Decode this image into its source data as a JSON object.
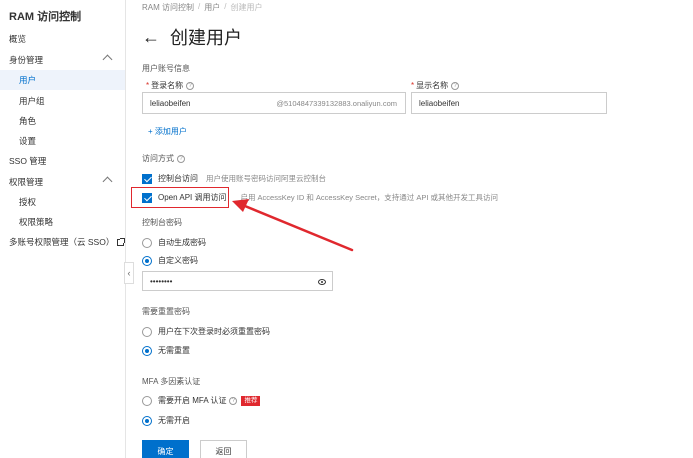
{
  "sidebar": {
    "title": "RAM 访问控制",
    "items": [
      {
        "label": "概览"
      },
      {
        "label": "身份管理"
      },
      {
        "label": "用户"
      },
      {
        "label": "用户组"
      },
      {
        "label": "角色"
      },
      {
        "label": "设置"
      },
      {
        "label": "SSO 管理"
      },
      {
        "label": "权限管理"
      },
      {
        "label": "授权"
      },
      {
        "label": "权限策略"
      },
      {
        "label": "多账号权限管理（云 SSO）"
      }
    ]
  },
  "breadcrumb": [
    "RAM 访问控制",
    "用户",
    "创建用户"
  ],
  "page": {
    "back_icon": "←",
    "title": "创建用户"
  },
  "account_info": {
    "section": "用户账号信息",
    "login_name_label": "登录名称",
    "display_name_label": "显示名称",
    "login_name_value": "leliaobeifen",
    "login_suffix": "@5104847339132883.onaliyun.com",
    "display_name_value": "leliaobeifen",
    "add_user": "+ 添加用户"
  },
  "access": {
    "section": "访问方式",
    "console_label": "控制台访问",
    "console_desc": "用户使用账号密码访问阿里云控制台",
    "api_label": "Open API 调用访问",
    "api_desc": "启用 AccessKey ID 和 AccessKey Secret，支持通过 API 或其他开发工具访问"
  },
  "console_password": {
    "section": "控制台密码",
    "auto": "自动生成密码",
    "custom": "自定义密码",
    "value": "••••••••"
  },
  "reset_password": {
    "section": "需要重置密码",
    "next_login": "用户在下次登录时必须重置密码",
    "no_reset": "无需重置"
  },
  "mfa": {
    "section": "MFA 多因素认证",
    "require": "需要开启 MFA 认证",
    "badge": "推荐",
    "no_need": "无需开启"
  },
  "buttons": {
    "confirm": "确定",
    "back": "返回"
  },
  "colors": {
    "accent": "#0070cc",
    "highlight": "#e0282e"
  }
}
